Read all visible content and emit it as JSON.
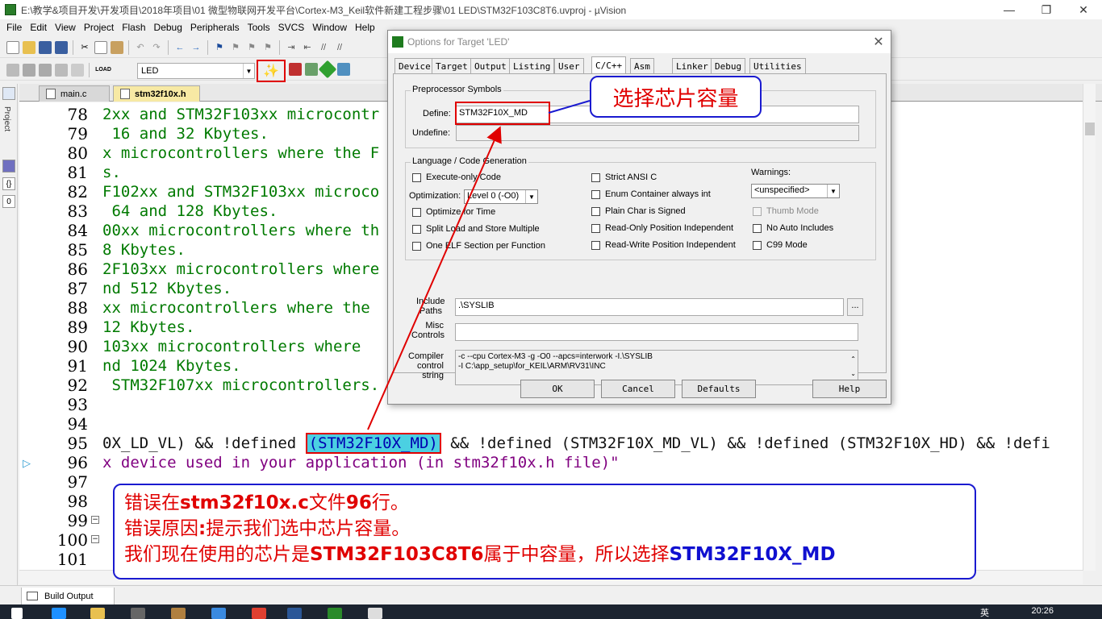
{
  "window": {
    "title": "E:\\教学&项目开发\\开发项目\\2018年项目\\01 微型物联网开发平台\\Cortex-M3_Keil软件新建工程步骤\\01 LED\\STM32F103C8T6.uvproj - µVision"
  },
  "menu": [
    "File",
    "Edit",
    "View",
    "Project",
    "Flash",
    "Debug",
    "Peripherals",
    "Tools",
    "SVCS",
    "Window",
    "Help"
  ],
  "toolbar": {
    "target": "LED",
    "load_label": "LOAD"
  },
  "sidebar": {
    "project_label": "Project"
  },
  "tabs": [
    "main.c",
    "stm32f10x.h"
  ],
  "editor": {
    "lines": [
      {
        "n": "78",
        "code": "2xx and STM32F103xx microcontr"
      },
      {
        "n": "79",
        "code": " 16 and 32 Kbytes."
      },
      {
        "n": "80",
        "code": "x microcontrollers where the F"
      },
      {
        "n": "81",
        "code": "s."
      },
      {
        "n": "82",
        "code": "F102xx and STM32F103xx microco"
      },
      {
        "n": "83",
        "code": " 64 and 128 Kbytes."
      },
      {
        "n": "84",
        "code": "00xx microcontrollers where th"
      },
      {
        "n": "85",
        "code": "8 Kbytes."
      },
      {
        "n": "86",
        "code": "2F103xx microcontrollers where"
      },
      {
        "n": "87",
        "code": "nd 512 Kbytes."
      },
      {
        "n": "88",
        "code": "xx microcontrollers where the"
      },
      {
        "n": "89",
        "code": "12 Kbytes."
      },
      {
        "n": "90",
        "code": "103xx microcontrollers where"
      },
      {
        "n": "91",
        "code": "nd 1024 Kbytes."
      },
      {
        "n": "92",
        "code": " STM32F107xx microcontrollers."
      },
      {
        "n": "93",
        "code": ""
      },
      {
        "n": "94",
        "code": ""
      },
      {
        "n": "95",
        "code": ""
      },
      {
        "n": "96",
        "code": "x device used in your application (in stm32f10x.h file)\""
      },
      {
        "n": "97",
        "code": ""
      },
      {
        "n": "98",
        "code": ""
      },
      {
        "n": "99",
        "code": ""
      },
      {
        "n": "100",
        "code": ""
      },
      {
        "n": "101",
        "code": ""
      }
    ],
    "line95_pre": "0X_LD_VL) && !defined ",
    "line95_hl": "(STM32F10X_MD)",
    "line95_post": " && !defined (STM32F10X_MD_VL) && !defined (STM32F10X_HD) && !defi"
  },
  "build": {
    "tab_label": "Build Output"
  },
  "dialog": {
    "title": "Options for Target 'LED'",
    "tabs": [
      "Device",
      "Target",
      "Output",
      "Listing",
      "User",
      "C/C++",
      "Asm",
      "Linker",
      "Debug",
      "Utilities"
    ],
    "active_tab": "C/C++",
    "preprocessor": {
      "group_label": "Preprocessor Symbols",
      "define_label": "Define:",
      "define_value": "STM32F10X_MD",
      "undefine_label": "Undefine:"
    },
    "codegen": {
      "group_label": "Language / Code Generation",
      "execute_only": "Execute-only Code",
      "optimization_label": "Optimization:",
      "optimization_value": "Level 0 (-O0)",
      "optimize_time": "Optimize for Time",
      "split_load": "Split Load and Store Multiple",
      "one_elf": "One ELF Section per Function",
      "strict_ansi": "Strict ANSI C",
      "enum_container": "Enum Container always int",
      "plain_char": "Plain Char is Signed",
      "ro_pi": "Read-Only Position Independent",
      "rw_pi": "Read-Write Position Independent",
      "warnings_label": "Warnings:",
      "warnings_value": "<unspecified>",
      "thumb_mode": "Thumb Mode",
      "no_auto_includes": "No Auto Includes",
      "c99_mode": "C99 Mode"
    },
    "paths": {
      "include_label_1": "Include",
      "include_label_2": "Paths",
      "include_value": ".\\SYSLIB",
      "browse": "...",
      "misc_label_1": "Misc",
      "misc_label_2": "Controls",
      "compiler_label_1": "Compiler",
      "compiler_label_2": "control",
      "compiler_label_3": "string",
      "compiler_line_1": "-c --cpu Cortex-M3 -g -O0 --apcs=interwork -I.\\SYSLIB",
      "compiler_line_2": "-I C:\\app_setup\\for_KEIL\\ARM\\RV31\\INC"
    },
    "buttons": {
      "ok": "OK",
      "cancel": "Cancel",
      "defaults": "Defaults",
      "help": "Help"
    }
  },
  "annotations": {
    "callout": "选择芯片容量",
    "note_1_pre": "错误在",
    "note_1_bold": "stm32f10x.c",
    "note_1_mid": "文件",
    "note_1_bold2": "96",
    "note_1_post": "行。",
    "note_2_pre": "错误原因",
    "note_2_bold": ":",
    "note_2_post": "提示我们选中芯片容量。",
    "note_3_pre": "我们现在使用的芯片是",
    "note_3_bold": "STM32F103C8T6",
    "note_3_mid": "属于中容量，所以选择",
    "note_3_blue": "STM32F10X_MD"
  },
  "taskbar": {
    "clock": "20:26",
    "lang": "英"
  },
  "colors": {
    "annotation_red": "#e00000",
    "annotation_blue": "#1a1ad0",
    "code_green": "#007a00",
    "highlight_cyan": "#4bd0e2"
  }
}
